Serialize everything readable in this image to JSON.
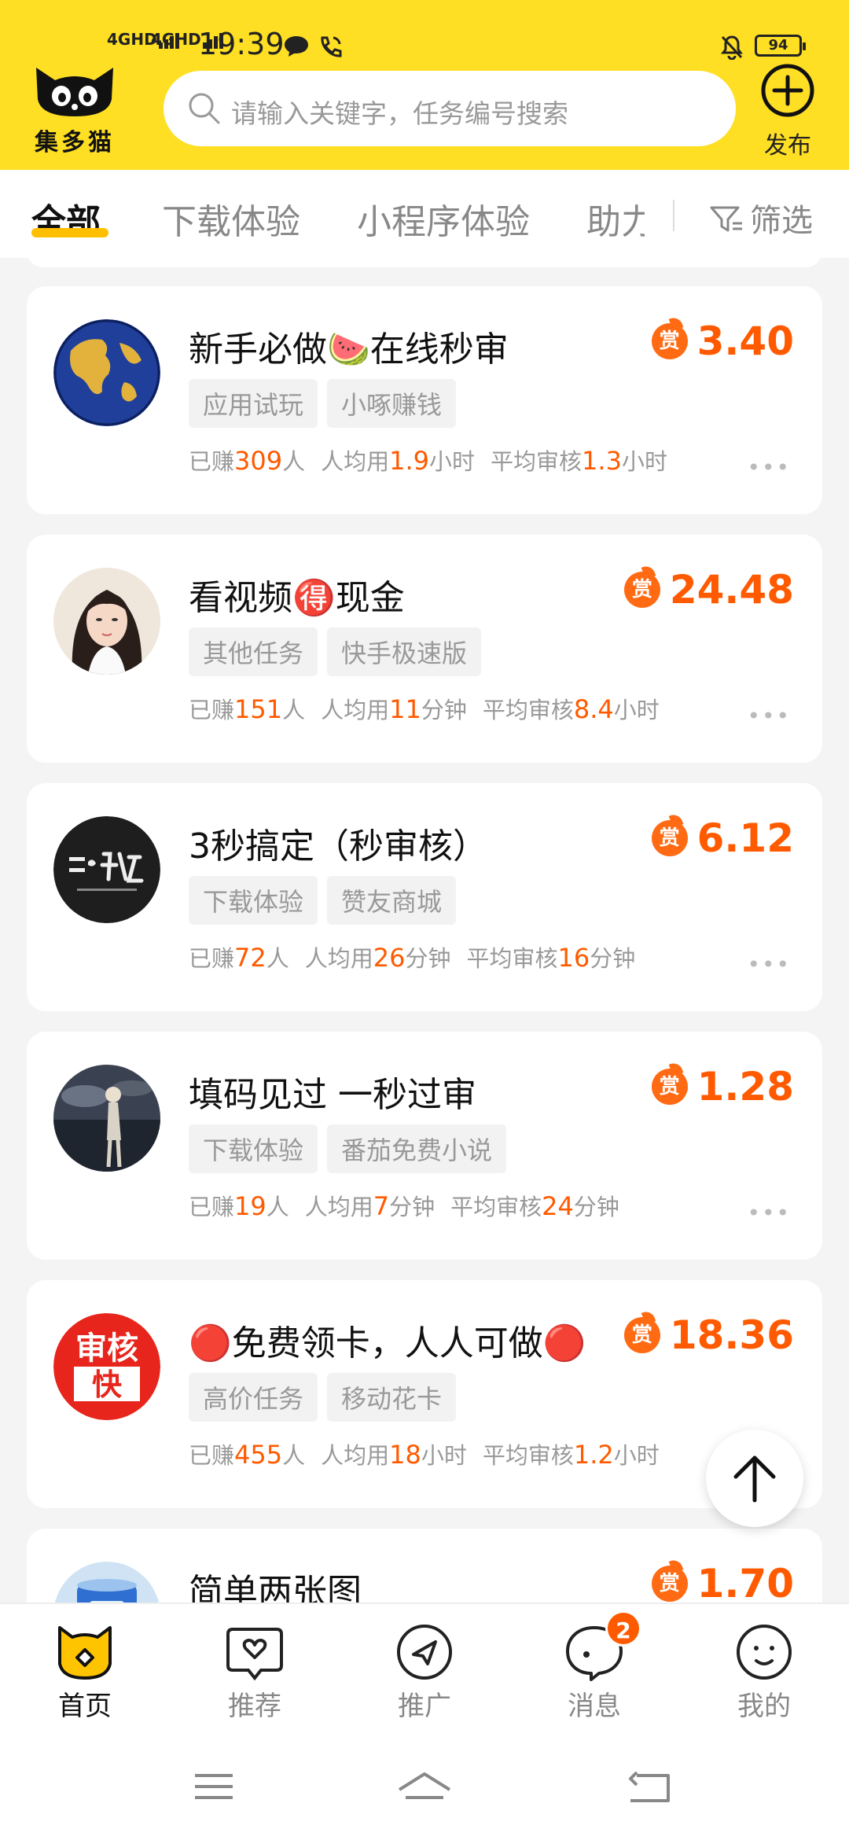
{
  "status_bar": {
    "signal1": "4GHD",
    "signal2": "4GHD",
    "time": "19:39",
    "battery": "94"
  },
  "app": {
    "logo_text": "集多猫",
    "search_placeholder": "请输入关键字，任务编号搜索",
    "publish_label": "发布"
  },
  "tabs": {
    "items": [
      "全部",
      "下载体验",
      "小程序体验",
      "助力"
    ],
    "active": "全部",
    "filter_label": "筛选"
  },
  "tasks": [
    {
      "title": "新手必做🍉在线秒审",
      "reward_badge": "赏",
      "reward": "3.40",
      "tags": [
        "应用试玩",
        "小啄赚钱"
      ],
      "earned_prefix": "已赚",
      "earned": "309",
      "earned_suffix": "人",
      "avg_prefix": "人均用",
      "avg_time": "1.9",
      "avg_unit": "小时",
      "review_prefix": "平均审核",
      "review_time": "1.3",
      "review_unit": "小时",
      "avatar": "globe"
    },
    {
      "title": "看视频🉐现金",
      "reward_badge": "赏",
      "reward": "24.48",
      "tags": [
        "其他任务",
        "快手极速版"
      ],
      "earned_prefix": "已赚",
      "earned": "151",
      "earned_suffix": "人",
      "avg_prefix": "人均用",
      "avg_time": "11",
      "avg_unit": "分钟",
      "review_prefix": "平均审核",
      "review_time": "8.4",
      "review_unit": "小时",
      "avatar": "woman"
    },
    {
      "title": "3秒搞定（秒审核）",
      "reward_badge": "赏",
      "reward": "6.12",
      "tags": [
        "下载体验",
        "赞友商城"
      ],
      "earned_prefix": "已赚",
      "earned": "72",
      "earned_suffix": "人",
      "avg_prefix": "人均用",
      "avg_time": "26",
      "avg_unit": "分钟",
      "review_prefix": "平均审核",
      "review_time": "16",
      "review_unit": "分钟",
      "avatar": "dark-text"
    },
    {
      "title": "填码见过  一秒过审",
      "reward_badge": "赏",
      "reward": "1.28",
      "tags": [
        "下载体验",
        "番茄免费小说"
      ],
      "earned_prefix": "已赚",
      "earned": "19",
      "earned_suffix": "人",
      "avg_prefix": "人均用",
      "avg_time": "7",
      "avg_unit": "分钟",
      "review_prefix": "平均审核",
      "review_time": "24",
      "review_unit": "分钟",
      "avatar": "night-figure"
    },
    {
      "title": "🔴免费领卡，人人可做🔴",
      "reward_badge": "赏",
      "reward": "18.36",
      "tags": [
        "高价任务",
        "移动花卡"
      ],
      "earned_prefix": "已赚",
      "earned": "455",
      "earned_suffix": "人",
      "avg_prefix": "人均用",
      "avg_time": "18",
      "avg_unit": "小时",
      "review_prefix": "平均审核",
      "review_time": "1.2",
      "review_unit": "小时",
      "avatar": "red-stamp",
      "avatar_text_top": "审核",
      "avatar_text_bottom": "快"
    },
    {
      "title": "简单两张图",
      "reward_badge": "赏",
      "reward": "1.70",
      "avatar": "blue-can"
    }
  ],
  "more_label": "•••",
  "bottom_nav": {
    "items": [
      "首页",
      "推荐",
      "推广",
      "消息",
      "我的"
    ],
    "active": "首页",
    "message_badge": "2"
  },
  "colors": {
    "brand_yellow": "#ffdf23",
    "accent_orange": "#ff5a00",
    "tab_underline": "#ffbf00"
  }
}
